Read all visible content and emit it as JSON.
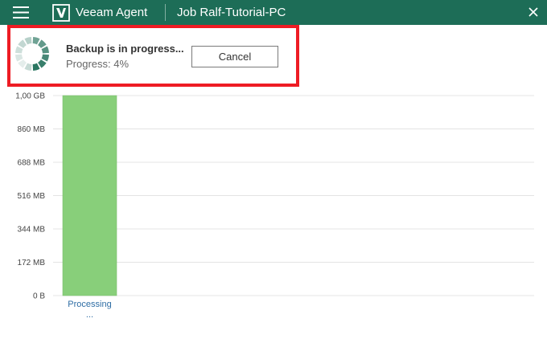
{
  "app": {
    "name": "Veeam Agent",
    "job_title": "Job Ralf-Tutorial-PC",
    "header_color": "#1d6d57"
  },
  "icons": [
    "hamburger-menu-icon",
    "veeam-logo-icon",
    "close-icon",
    "loading-spinner-icon"
  ],
  "status": {
    "title": "Backup is in progress...",
    "progress_text": "Progress: 4%",
    "progress_value": 4,
    "cancel_label": "Cancel",
    "highlight_color": "#ee1c24"
  },
  "chart_data": {
    "type": "bar",
    "y_tick_labels": [
      "0 B",
      "172 MB",
      "344 MB",
      "516 MB",
      "688 MB",
      "860 MB",
      "1,00 GB"
    ],
    "categories": [
      [
        "Processing",
        "..."
      ]
    ],
    "values": [
      1.0
    ],
    "ylim": [
      0,
      1.0
    ],
    "y_unit": "GB",
    "bar_color": "#88cf7a",
    "grid": true
  }
}
